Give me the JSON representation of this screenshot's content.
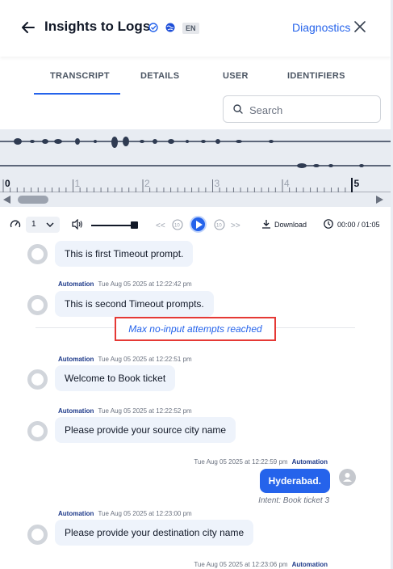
{
  "header": {
    "title": "Insights to Logs",
    "language_badge": "EN",
    "diagnostics_label": "Diagnostics"
  },
  "tabs": [
    {
      "label": "TRANSCRIPT",
      "active": true
    },
    {
      "label": "DETAILS",
      "active": false
    },
    {
      "label": "USER",
      "active": false
    },
    {
      "label": "IDENTIFIERS",
      "active": false
    }
  ],
  "search": {
    "placeholder": "Search",
    "value": ""
  },
  "timeline": {
    "ticks": [
      "0",
      "1",
      "2",
      "3",
      "4",
      "5"
    ],
    "playhead_at": "5"
  },
  "player": {
    "speed": "1",
    "volume_level": 0.95,
    "download_label": "Download",
    "time": "00:00 / 01:05"
  },
  "transcript": {
    "messages": [
      {
        "text": "This is first Timeout prompt."
      },
      {
        "speaker": "Automation",
        "timestamp": "Tue Aug 05 2025 at 12:22:42 pm",
        "text": "This is second Timeout prompts."
      },
      {
        "status": "Max no-input attempts reached"
      },
      {
        "speaker": "Automation",
        "timestamp": "Tue Aug 05 2025 at 12:22:51 pm",
        "text": "Welcome to Book ticket"
      },
      {
        "speaker": "Automation",
        "timestamp": "Tue Aug 05 2025 at 12:22:52 pm",
        "text": "Please provide your source city name"
      },
      {
        "speaker": "Automation",
        "timestamp": "Tue Aug 05 2025 at 12:22:59 pm",
        "text": "Hyderabad.",
        "from_user": true,
        "intent": "Intent: Book ticket 3"
      },
      {
        "speaker": "Automation",
        "timestamp": "Tue Aug 05 2025 at 12:23:00 pm",
        "text": "Please provide your destination city name"
      },
      {
        "speaker": "Automation",
        "timestamp": "Tue Aug 05 2025 at 12:23:06 pm",
        "from_user": true
      }
    ]
  },
  "colors": {
    "accent": "#2563eb",
    "status_border": "#e53935",
    "bot_bubble": "#eef3fb",
    "waveform": "#2f3b52"
  }
}
